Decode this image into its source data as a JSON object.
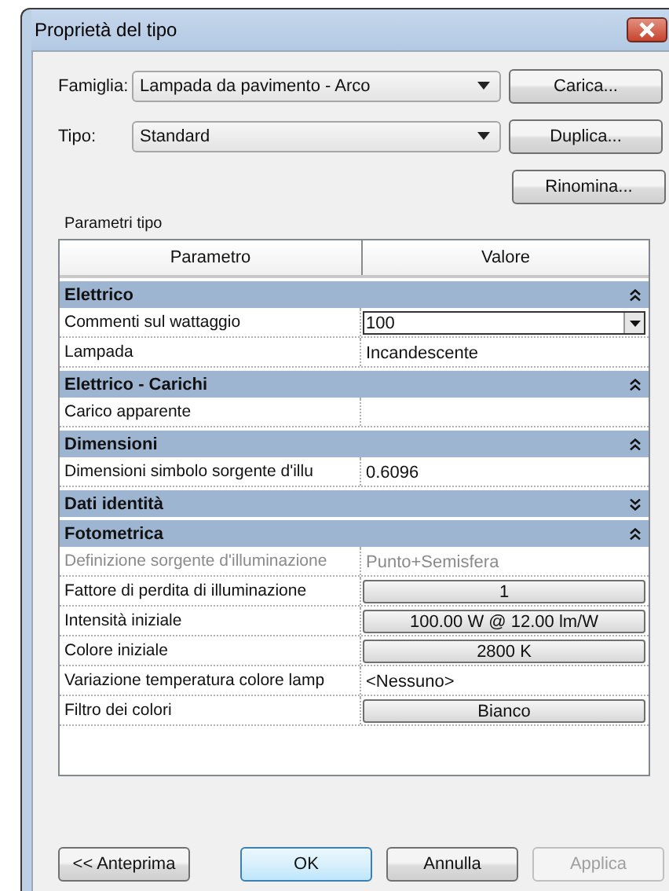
{
  "window": {
    "title": "Proprietà del tipo"
  },
  "family": {
    "label": "Famiglia:",
    "value": "Lampada da pavimento - Arco",
    "button": "Carica..."
  },
  "type": {
    "label": "Tipo:",
    "value": "Standard",
    "button": "Duplica..."
  },
  "rename_button": "Rinomina...",
  "section_label": "Parametri tipo",
  "table": {
    "columns": [
      "Parametro",
      "Valore"
    ],
    "groups": [
      {
        "name": "Elettrico",
        "expanded": true,
        "rows": [
          {
            "param": "Commenti sul wattaggio",
            "value": "100",
            "kind": "dropdown",
            "disabled": false
          },
          {
            "param": "Lampada",
            "value": "Incandescente",
            "kind": "text",
            "disabled": false
          }
        ]
      },
      {
        "name": "Elettrico - Carichi",
        "expanded": true,
        "rows": [
          {
            "param": "Carico apparente",
            "kind": "text",
            "disabled": false
          }
        ]
      },
      {
        "name": "Dimensioni",
        "expanded": true,
        "rows": [
          {
            "param": "Dimensioni simbolo sorgente d'illu",
            "value": "0.6096",
            "kind": "text",
            "disabled": false
          }
        ]
      },
      {
        "name": "Dati identità",
        "expanded": false
      },
      {
        "name": "Fotometrica",
        "expanded": true,
        "rows": [
          {
            "param": "Definizione sorgente d'illuminazione",
            "value": "Punto+Semisfera",
            "kind": "text",
            "disabled": true
          },
          {
            "param": "Fattore di perdita di illuminazione",
            "value": "1",
            "kind": "button",
            "disabled": false
          },
          {
            "param": "Intensità iniziale",
            "value": "100.00 W @ 12.00 lm/W",
            "kind": "button",
            "disabled": false
          },
          {
            "param": "Colore iniziale",
            "value": "2800 K",
            "kind": "button",
            "disabled": false
          },
          {
            "param": "Variazione temperatura colore lamp",
            "value": "<Nessuno>",
            "kind": "text",
            "disabled": false
          },
          {
            "param": "Filtro dei colori",
            "value": "Bianco",
            "kind": "button",
            "disabled": false
          }
        ]
      }
    ]
  },
  "buttons": [
    {
      "label": "<< Anteprima",
      "default": false,
      "disabled": false
    },
    {
      "label": "OK",
      "default": true,
      "disabled": false
    },
    {
      "label": "Annulla",
      "default": false,
      "disabled": false
    },
    {
      "label": "Applica",
      "default": false,
      "disabled": true
    }
  ]
}
